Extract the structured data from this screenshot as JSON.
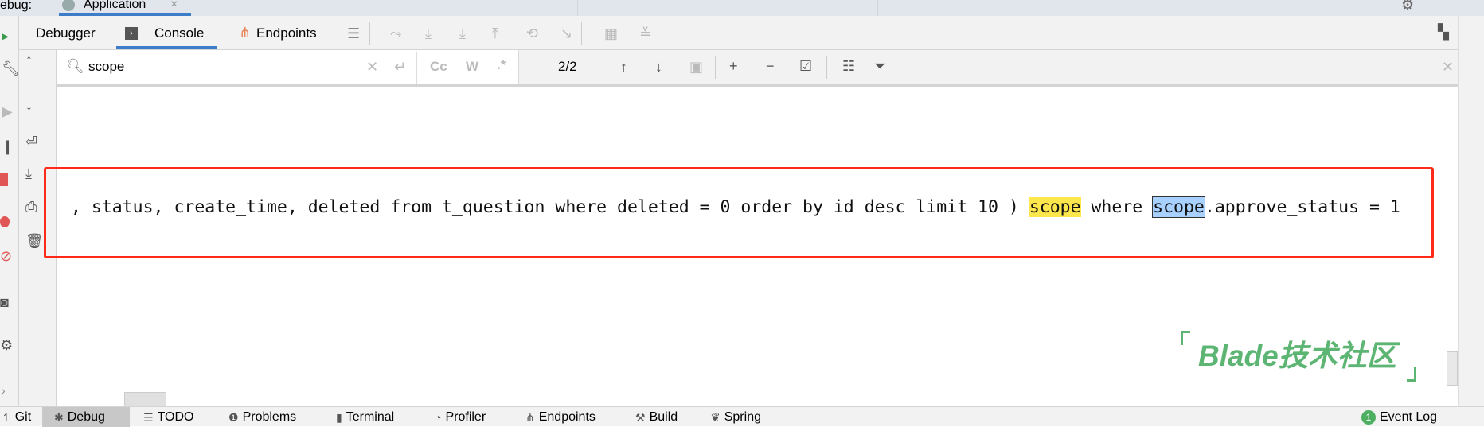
{
  "top_tabs": {
    "prev_label": "ebug:",
    "active_tab": "Application",
    "close_icon": "×"
  },
  "toolbar": {
    "tabs": [
      {
        "label": "Debugger"
      },
      {
        "label": "Console"
      },
      {
        "label": "Endpoints"
      }
    ],
    "active": "Console"
  },
  "search": {
    "value": "scope",
    "match_case": "Cc",
    "words": "W",
    "regex": ".*",
    "match_count": "2/2"
  },
  "console": {
    "before": ", status, create_time, deleted from t_question where deleted = 0 order by id desc limit 10 ) ",
    "match1": "scope",
    "middle": " where ",
    "match2": "scope",
    "after": ".approve_status = 1"
  },
  "watermark": {
    "text": "Blade技术社区"
  },
  "bottom_bar": {
    "items": [
      {
        "label": "Git"
      },
      {
        "label": "Debug"
      },
      {
        "label": "TODO"
      },
      {
        "label": "Problems"
      },
      {
        "label": "Terminal"
      },
      {
        "label": "Profiler"
      },
      {
        "label": "Endpoints"
      },
      {
        "label": "Build"
      },
      {
        "label": "Spring"
      }
    ],
    "event_log": {
      "count": "1",
      "label": "Event Log"
    }
  },
  "colors": {
    "accent": "#3d7cc9",
    "match_highlight": "#fde74c",
    "current_match": "#a8d1ff",
    "annotation_box": "#ff2a1a",
    "watermark": "#5db574"
  }
}
